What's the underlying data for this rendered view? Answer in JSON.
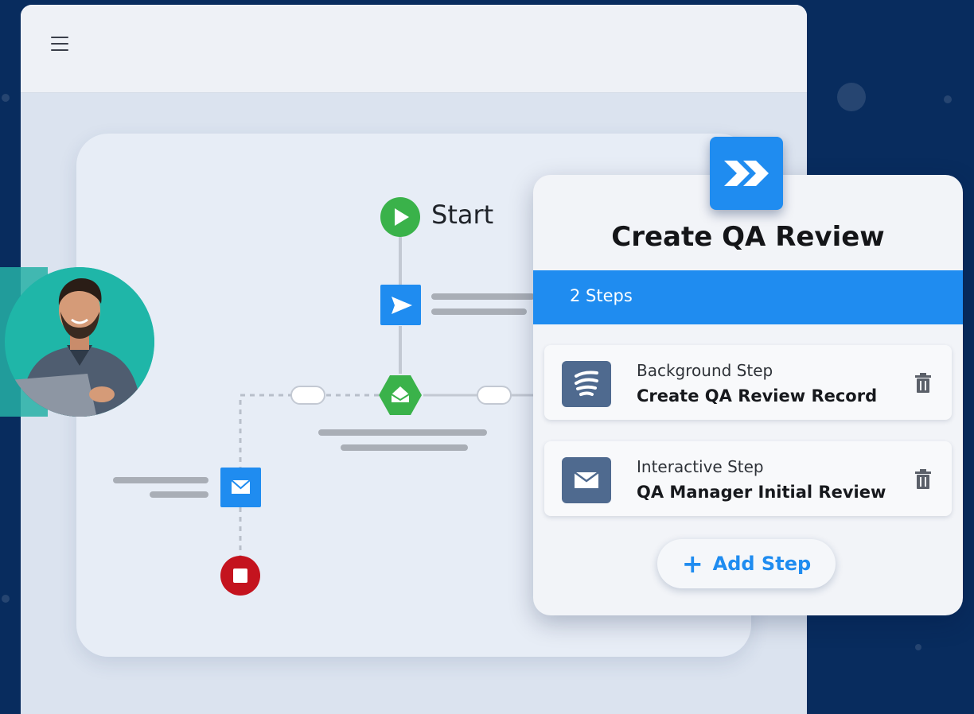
{
  "flow": {
    "start_label": "Start"
  },
  "panel": {
    "title": "Create QA Review",
    "steps_count": "2 Steps",
    "steps": [
      {
        "type": "Background Step",
        "name": "Create QA Review Record",
        "icon": "waves-icon"
      },
      {
        "type": "Interactive Step",
        "name": "QA Manager Initial Review",
        "icon": "envelope-icon"
      }
    ],
    "add_step_label": "Add Step"
  },
  "colors": {
    "background": "#082c5e",
    "accent_blue": "#1f8cf0",
    "start_green": "#3ab24a",
    "stop_red": "#c4131e",
    "step_icon_bg": "#4f6a8f"
  },
  "icons": {
    "menu": "hamburger-icon",
    "badge": "double-chevron-right-icon",
    "start": "play-icon",
    "send": "paper-plane-icon",
    "decision": "hexagon-icon",
    "email": "envelope-icon",
    "stop": "stop-icon",
    "delete": "trash-icon",
    "add": "plus-icon"
  }
}
